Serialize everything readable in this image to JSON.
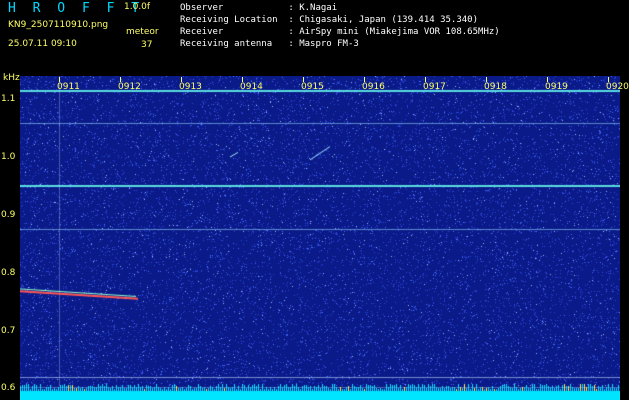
{
  "header": {
    "brand": "H R O F F T",
    "version": "1.0.0f",
    "filename": "KN9_2507110910.png",
    "meteor_label": "meteor",
    "datetime": "25.07.11 09:10",
    "meteor_count": "37",
    "info": [
      {
        "key": "Observer",
        "value": "K.Nagai"
      },
      {
        "key": "Receiving Location",
        "value": "Chigasaki, Japan (139.414 35.340)"
      },
      {
        "key": "Receiver",
        "value": "AirSpy mini (Miakejima VOR 108.65MHz)"
      },
      {
        "key": "Receiving antenna",
        "value": "Maspro FM-3"
      }
    ]
  },
  "chart_data": {
    "type": "heatmap",
    "ylabel": "kHz",
    "y_ticks": [
      "1.1",
      "1.0",
      "0.9",
      "0.8",
      "0.7",
      "0.6"
    ],
    "x_ticks": [
      "0911",
      "0912",
      "0913",
      "0914",
      "0915",
      "0916",
      "0917",
      "0918",
      "0919",
      "0920"
    ],
    "ylim": [
      0.58,
      1.14
    ],
    "colors": {
      "background": "#0a1a88",
      "noise": "#4a6cff",
      "trace": "#66ffee",
      "meteor": "#ff5555",
      "bottom_band": "#00e5ff"
    }
  }
}
